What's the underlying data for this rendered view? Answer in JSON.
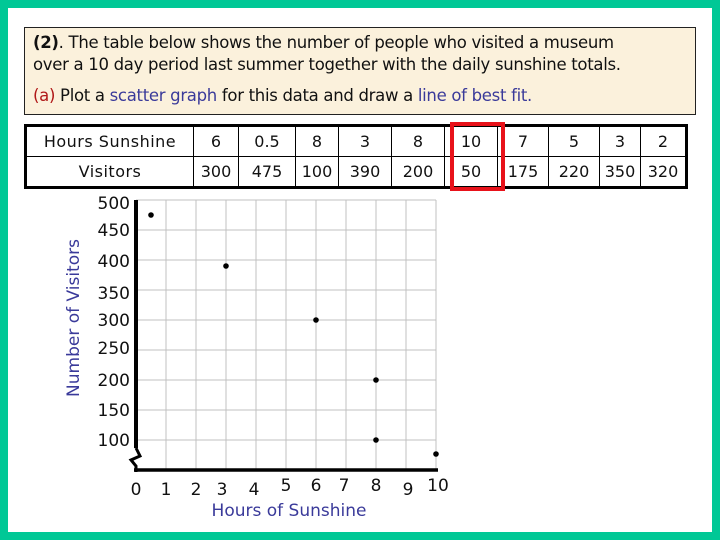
{
  "question": {
    "number": "(2)",
    "line1_rest": ". The table below shows the number of people who visited a museum",
    "line2": "over a 10 day period last summer together with the daily sunshine totals.",
    "part_label": "(a)",
    "part_text_1": " Plot a ",
    "part_highlight_1": "scatter graph",
    "part_text_2": " for this data and draw a ",
    "part_highlight_2": "line of best fit."
  },
  "table": {
    "row_headers": [
      "Hours Sunshine",
      "Visitors"
    ],
    "hours": [
      "6",
      "0.5",
      "8",
      "3",
      "8",
      "10",
      "7",
      "5",
      "3",
      "2"
    ],
    "visitors": [
      "300",
      "475",
      "100",
      "390",
      "200",
      "50",
      "175",
      "220",
      "350",
      "320"
    ],
    "highlighted_column_index": 5
  },
  "colors": {
    "frame": "#00c896",
    "question_bg": "#fbf1dc",
    "accent_red": "#b01818",
    "accent_blue": "#3a3a9a",
    "highlight_box": "#e8121a",
    "grid": "#c0c0c0"
  },
  "chart_data": {
    "type": "scatter",
    "title": "",
    "xlabel": "Hours of Sunshine",
    "ylabel": "Number of Visitors",
    "xlim": [
      0,
      10
    ],
    "ylim": [
      100,
      500
    ],
    "y_axis_break": true,
    "grid": true,
    "x_ticks": [
      "0",
      "1",
      "2",
      "3",
      "4",
      "5",
      "6",
      "7",
      "8",
      "9",
      "10"
    ],
    "y_ticks": [
      "100",
      "150",
      "200",
      "250",
      "300",
      "350",
      "400",
      "450",
      "500"
    ],
    "points": [
      {
        "x": 0.5,
        "y": 475
      },
      {
        "x": 3,
        "y": 390
      },
      {
        "x": 6,
        "y": 300
      },
      {
        "x": 8,
        "y": 200
      },
      {
        "x": 8,
        "y": 100
      },
      {
        "x": 10,
        "y": 50
      }
    ]
  }
}
